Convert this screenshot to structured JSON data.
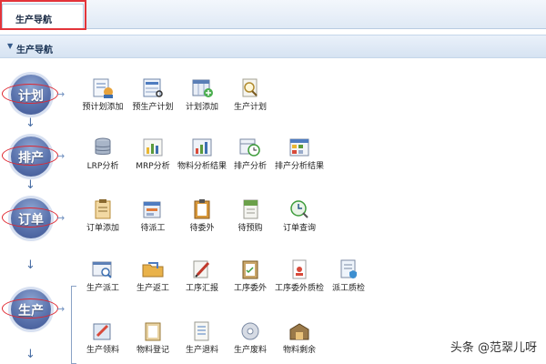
{
  "tab": {
    "label": "生产导航"
  },
  "section": {
    "title": "生产导航"
  },
  "steps": [
    {
      "label": "计划"
    },
    {
      "label": "排产"
    },
    {
      "label": "订单"
    },
    {
      "label": "生产"
    }
  ],
  "plan": [
    {
      "label": "预计划添加",
      "icon": "plan-add-icon"
    },
    {
      "label": "预生产计划",
      "icon": "preproduction-plan-icon"
    },
    {
      "label": "计划添加",
      "icon": "plan-grid-add-icon"
    },
    {
      "label": "生产计划",
      "icon": "search-doc-icon"
    }
  ],
  "schedule": [
    {
      "label": "LRP分析",
      "icon": "database-icon"
    },
    {
      "label": "MRP分析",
      "icon": "bar-chart-icon"
    },
    {
      "label": "物料分析结果",
      "icon": "chart-result-icon"
    },
    {
      "label": "排产分析",
      "icon": "clock-table-icon"
    },
    {
      "label": "排产分析结果",
      "icon": "table-result-icon"
    }
  ],
  "order": [
    {
      "label": "订单添加",
      "icon": "clipboard-add-icon"
    },
    {
      "label": "待派工",
      "icon": "dispatch-pending-icon"
    },
    {
      "label": "待委外",
      "icon": "clipboard-icon"
    },
    {
      "label": "待预购",
      "icon": "xls-doc-icon"
    },
    {
      "label": "订单查询",
      "icon": "clock-search-icon"
    }
  ],
  "production": [
    {
      "label": "生产派工",
      "icon": "window-search-icon"
    },
    {
      "label": "生产返工",
      "icon": "folder-rework-icon"
    },
    {
      "label": "工序汇报",
      "icon": "pen-report-icon"
    },
    {
      "label": "工序委外",
      "icon": "clipboard-check-icon"
    },
    {
      "label": "工序委外质检",
      "icon": "doc-person-icon"
    },
    {
      "label": "派工质检",
      "icon": "shield-doc-icon"
    }
  ],
  "production_row2": [
    {
      "label": "生产领料",
      "icon": "pencil-box-icon"
    },
    {
      "label": "物料登记",
      "icon": "clipboard-plain-icon"
    },
    {
      "label": "生产退料",
      "icon": "list-doc-icon"
    },
    {
      "label": "生产废料",
      "icon": "recycle-disc-icon"
    },
    {
      "label": "物料剩余",
      "icon": "warehouse-icon"
    }
  ],
  "watermark": "头条 @范翠儿呀"
}
